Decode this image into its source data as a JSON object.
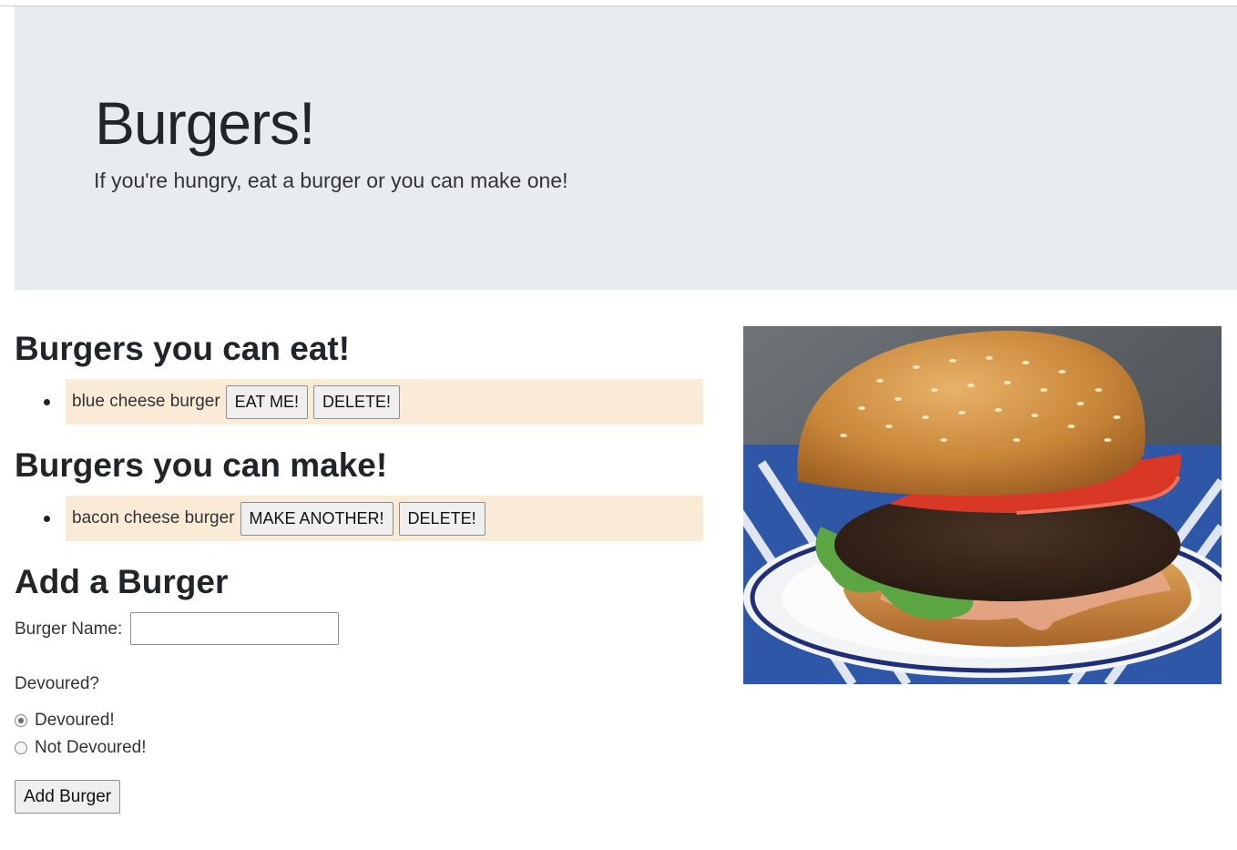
{
  "jumbotron": {
    "title": "Burgers!",
    "lead": "If you're hungry, eat a burger or you can make one!"
  },
  "eat_section": {
    "heading": "Burgers you can eat!",
    "items": [
      {
        "name": "blue cheese burger",
        "primary_label": "EAT ME!",
        "delete_label": "DELETE!"
      }
    ]
  },
  "make_section": {
    "heading": "Burgers you can make!",
    "items": [
      {
        "name": "bacon cheese burger",
        "primary_label": "MAKE ANOTHER!",
        "delete_label": "DELETE!"
      }
    ]
  },
  "add_form": {
    "heading": "Add a Burger",
    "name_label": "Burger Name:",
    "name_value": "",
    "devoured_label": "Devoured?",
    "options": [
      {
        "label": "Devoured!",
        "checked": true
      },
      {
        "label": "Not Devoured!",
        "checked": false
      }
    ],
    "submit_label": "Add Burger"
  },
  "image": {
    "subject": "burger-photo"
  }
}
